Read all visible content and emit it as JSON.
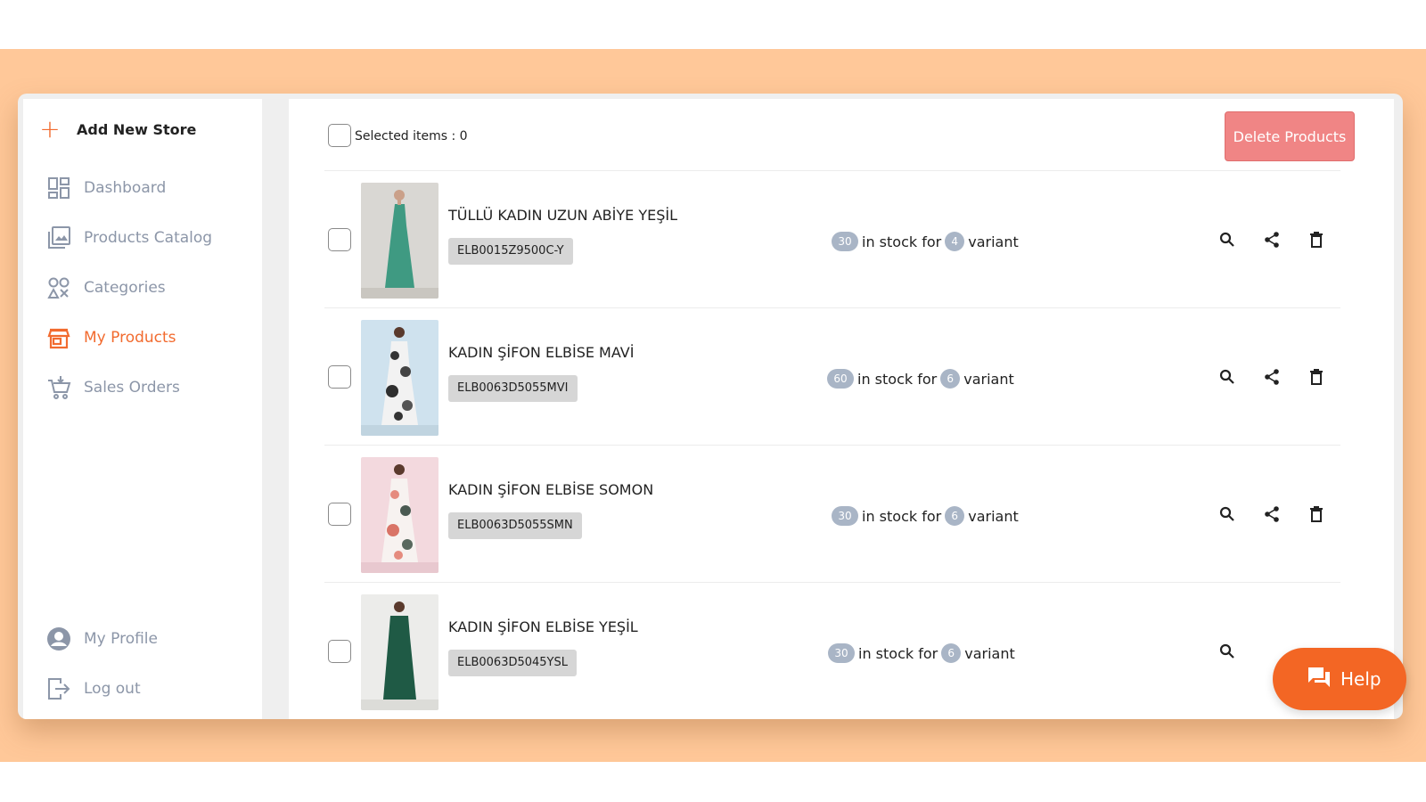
{
  "sidebar": {
    "add_store": "Add New Store",
    "items": [
      {
        "label": "Dashboard",
        "icon": "dashboard-icon"
      },
      {
        "label": "Products Catalog",
        "icon": "image-gallery-icon"
      },
      {
        "label": "Categories",
        "icon": "categories-icon"
      },
      {
        "label": "My Products",
        "icon": "store-icon",
        "active": true
      },
      {
        "label": "Sales Orders",
        "icon": "cart-icon"
      }
    ],
    "bottom": [
      {
        "label": "My Profile",
        "icon": "profile-icon"
      },
      {
        "label": "Log out",
        "icon": "logout-icon"
      }
    ]
  },
  "toolbar": {
    "selected_label": "Selected items : 0",
    "delete_label": "Delete Products"
  },
  "products": [
    {
      "title": "TÜLLÜ KADIN UZUN ABİYE YEŞİL",
      "sku": "ELB0015Z9500C-Y",
      "stock": "30",
      "variants": "4",
      "in_stock_text": "in stock for",
      "variant_text": "variant"
    },
    {
      "title": "KADIN ŞİFON ELBİSE MAVİ",
      "sku": "ELB0063D5055MVI",
      "stock": "60",
      "variants": "6",
      "in_stock_text": "in stock for",
      "variant_text": "variant"
    },
    {
      "title": "KADIN ŞİFON ELBİSE SOMON",
      "sku": "ELB0063D5055SMN",
      "stock": "30",
      "variants": "6",
      "in_stock_text": "in stock for",
      "variant_text": "variant"
    },
    {
      "title": "KADIN ŞİFON ELBİSE YEŞİL",
      "sku": "ELB0063D5045YSL",
      "stock": "30",
      "variants": "6",
      "in_stock_text": "in stock for",
      "variant_text": "variant"
    }
  ],
  "help": {
    "label": "Help"
  },
  "colors": {
    "accent": "#f26b2f",
    "background": "#ffc899",
    "delete": "#f08585",
    "pill": "#a9b5c6",
    "nav_inactive": "#8c96a8"
  }
}
